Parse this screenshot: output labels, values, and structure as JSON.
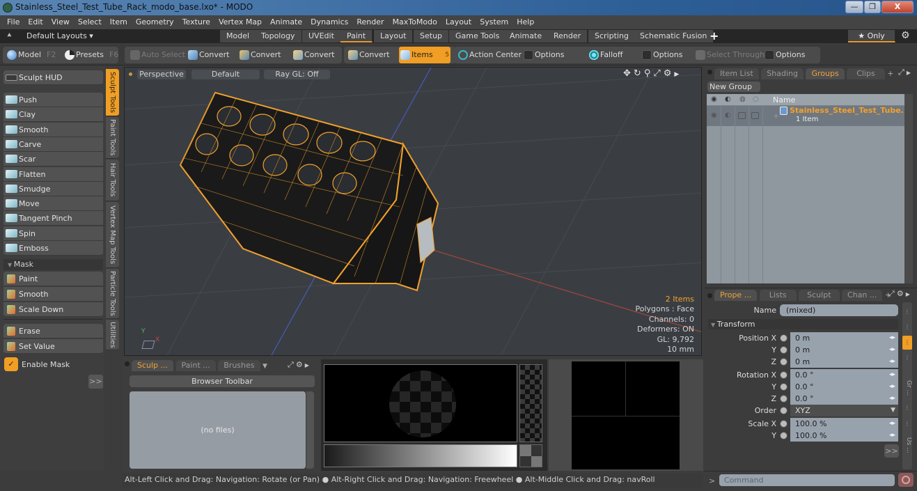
{
  "window": {
    "title": "Stainless_Steel_Test_Tube_Rack_modo_base.lxo* - MODO",
    "controls": {
      "minimize": "—",
      "restore": "❐",
      "close": "X"
    }
  },
  "menubar": [
    "File",
    "Edit",
    "View",
    "Select",
    "Item",
    "Geometry",
    "Texture",
    "Vertex Map",
    "Animate",
    "Dynamics",
    "Render",
    "MaxToModo",
    "Layout",
    "System",
    "Help"
  ],
  "layoutbar": {
    "layouts_label": "Default Layouts ▾",
    "tabs": [
      "Model",
      "Topology",
      "UVEdit",
      "Paint",
      "Layout",
      "Setup",
      "Game Tools",
      "Animate",
      "Render",
      "Scripting",
      "Schematic Fusion"
    ],
    "active_tab": "Paint",
    "add": "+",
    "only_label": "★ Only"
  },
  "toolbar": {
    "model": {
      "label": "Model",
      "key": "F2"
    },
    "presets": {
      "label": "Presets",
      "key": "F6"
    },
    "auto_select": "Auto Select",
    "convert": [
      "Convert",
      "Convert",
      "Convert",
      "Convert"
    ],
    "items": {
      "label": "Items",
      "key": "5"
    },
    "action_center": "Action Center",
    "options1": "Options",
    "falloff": "Falloff",
    "options2": "Options",
    "select_through": "Select Through",
    "options3": "Options"
  },
  "left_panel": {
    "sculpt_hud": "Sculpt HUD",
    "tools": [
      "Push",
      "Clay",
      "Smooth",
      "Carve",
      "Scar",
      "Flatten",
      "Smudge",
      "Move",
      "Tangent Pinch",
      "Spin",
      "Emboss"
    ],
    "mask_header": "Mask",
    "mask_tools": [
      "Paint",
      "Smooth",
      "Scale Down"
    ],
    "mask_tools2": [
      "Erase",
      "Set Value"
    ],
    "enable_mask": {
      "label": "Enable Mask",
      "checked": true
    },
    "more": ">>",
    "vertical_tabs": [
      "Sculpt Tools",
      "Paint Tools",
      "Hair Tools",
      "Vertex Map Tools",
      "Particle Tools",
      "Utilities"
    ],
    "active_vtab": "Sculpt Tools"
  },
  "viewport": {
    "view": "Perspective",
    "shading": "Default",
    "raygl": "Ray GL: Off",
    "hud": {
      "items": "2 Items",
      "polygons": "Polygons : Face",
      "channels": "Channels: 0",
      "deformers": "Deformers: ON",
      "gl": "GL: 9,792",
      "unit": "10 mm"
    },
    "axis": {
      "y": "Y",
      "x": "X"
    },
    "accent": "#f3a12c"
  },
  "brush_panel": {
    "tabs": [
      "Sculp ...",
      "Paint ...",
      "Brushes"
    ],
    "active_tab": "Sculp ...",
    "browser_toolbar": "Browser Toolbar",
    "empty": "(no files)"
  },
  "groups_panel": {
    "tabs": [
      "Item List",
      "Shading",
      "Groups",
      "Clips"
    ],
    "active_tab": "Groups",
    "new_group": "New Group",
    "col_name": "Name",
    "row": {
      "name": "Stainless_Steel_Test_Tube...",
      "sub": "1 Item"
    }
  },
  "properties": {
    "tabs": [
      "Prope ...",
      "Lists",
      "Sculpt",
      "Chan ..."
    ],
    "active_tab": "Prope ...",
    "name_label": "Name",
    "name_value": "(mixed)",
    "section": "Transform",
    "position": [
      {
        "label": "Position X",
        "value": "0 m"
      },
      {
        "label": "Y",
        "value": "0 m"
      },
      {
        "label": "Z",
        "value": "0 m"
      }
    ],
    "rotation": [
      {
        "label": "Rotation X",
        "value": "0.0 °"
      },
      {
        "label": "Y",
        "value": "0.0 °"
      },
      {
        "label": "Z",
        "value": "0.0 °"
      }
    ],
    "order": {
      "label": "Order",
      "value": "XYZ"
    },
    "scale": [
      {
        "label": "Scale X",
        "value": "100.0 %"
      },
      {
        "label": "Y",
        "value": "100.0 %"
      }
    ],
    "more": ">>",
    "side_tabs": [
      "Gr ...",
      "Us ..."
    ]
  },
  "command": {
    "prompt": ">",
    "placeholder": "Command"
  },
  "statusbar": "Alt-Left Click and Drag: Navigation: Rotate (or Pan) ● Alt-Right Click and Drag: Navigation: Freewheel ● Alt-Middle Click and Drag: navRoll"
}
